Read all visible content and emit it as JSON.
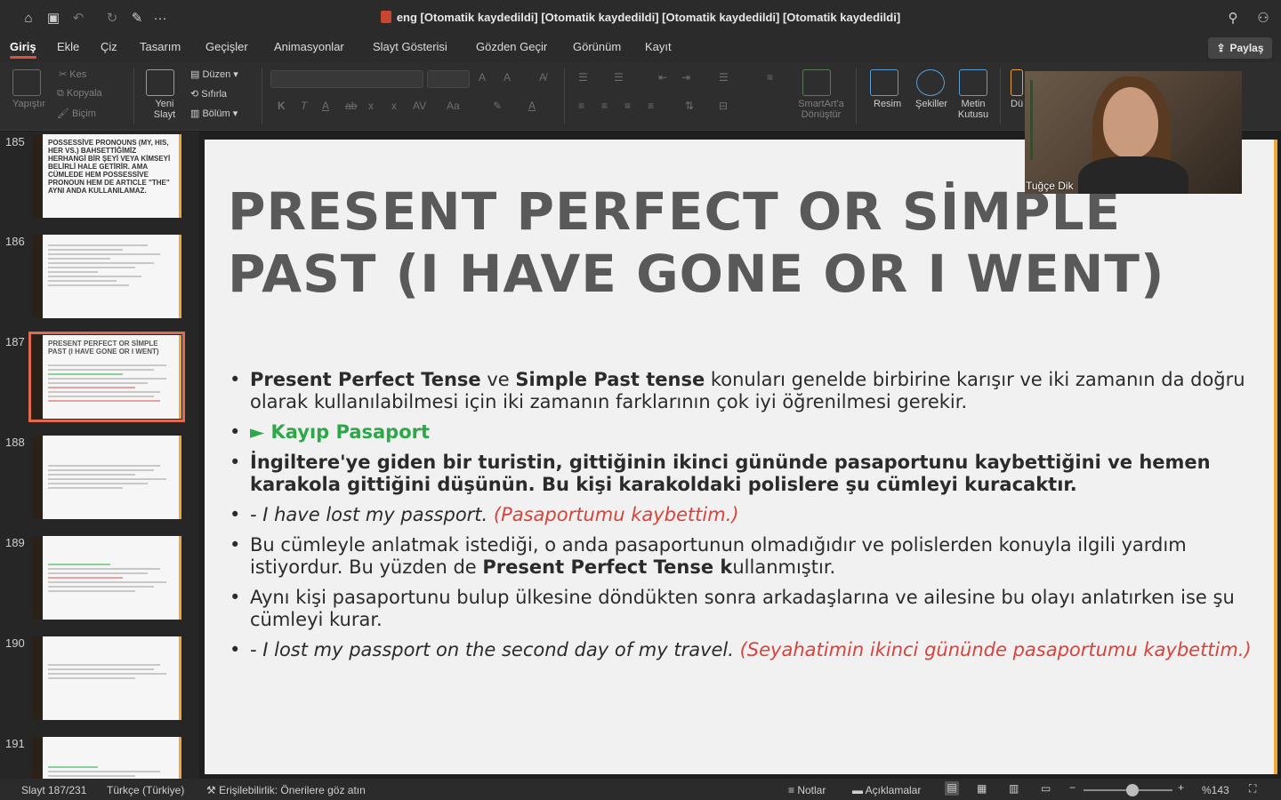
{
  "window": {
    "title": "eng [Otomatik kaydedildi] [Otomatik kaydedildi] [Otomatik kaydedildi] [Otomatik kaydedildi]"
  },
  "tabs": [
    "Giriş",
    "Ekle",
    "Çiz",
    "Tasarım",
    "Geçişler",
    "Animasyonlar",
    "Slayt Gösterisi",
    "Gözden Geçir",
    "Görünüm",
    "Kayıt"
  ],
  "share_label": "Paylaş",
  "ribbon": {
    "paste": "Yapıştır",
    "cut": "Kes",
    "copy": "Kopyala",
    "format": "Biçim",
    "new_slide": "Yeni Slayt",
    "layout": "Düzen",
    "reset": "Sıfırla",
    "section": "Bölüm",
    "smartart": "SmartArt'a Dönüştür",
    "picture": "Resim",
    "shapes": "Şekiller",
    "textbox": "Metin Kutusu",
    "arrange": "Dü"
  },
  "thumbnails": [
    {
      "num": "185",
      "text": "POSSESSİVE PRONOUNS (MY, HIS, HER VS.) BAHSETTİĞİMİZ HERHANGİ BİR ŞEYİ VEYA KİMSEYİ BELİRLİ HALE GETİRİR. AMA CÜMLEDE HEM POSSESSİVE PRONOUN HEM DE ARTICLE \"THE\" AYNI ANDA KULLANILAMAZ."
    },
    {
      "num": "186",
      "text": ""
    },
    {
      "num": "187",
      "text": "PRESENT PERFECT OR SİMPLE PAST (I HAVE GONE OR I WENT)"
    },
    {
      "num": "188",
      "text": ""
    },
    {
      "num": "189",
      "text": ""
    },
    {
      "num": "190",
      "text": ""
    },
    {
      "num": "191",
      "text": ""
    }
  ],
  "slide": {
    "title": "PRESENT PERFECT OR SİMPLE PAST (I HAVE GONE OR I WENT)",
    "b1_bold1": "Present Perfect Tense",
    "b1_t1": " ve ",
    "b1_bold2": "Simple Past tense",
    "b1_t2": " konuları genelde birbirine karışır ve iki zamanın da doğru olarak kullanılabilmesi için iki zamanın farklarının çok iyi öğrenilmesi gerekir.",
    "b2": "► Kayıp Pasaport",
    "b3": "İngiltere'ye giden bir turistin, gittiğinin ikinci gününde pasaportunu kaybettiğini ve hemen karakola gittiğini düşünün. Bu kişi karakoldaki polislere şu cümleyi kuracaktır.",
    "b4_en": "- I have lost my passport.",
    "b4_tr": " (Pasaportumu kaybettim.)",
    "b5_t1": "Bu cümleyle anlatmak istediği, o anda pasaportunun olmadığıdır ve polislerden konuyla ilgili yardım istiyordur. Bu yüzden de ",
    "b5_bold": "Present Perfect Tense k",
    "b5_t2": "ullanmıştır.",
    "b6": "Aynı kişi pasaportunu bulup ülkesine döndükten sonra arkadaşlarına ve ailesine bu olayı anlatırken ise şu cümleyi kurar.",
    "b7_en": "- I lost my passport on the second day of my travel.",
    "b7_tr": " (Seyahatimin ikinci gününde pasaportumu kaybettim.)"
  },
  "webcam_name": "Tuğçe Dik",
  "status": {
    "slide_pos": "Slayt 187/231",
    "language": "Türkçe (Türkiye)",
    "accessibility": "Erişilebilirlik: Önerilere göz atın",
    "notes": "Notlar",
    "comments": "Açıklamalar",
    "zoom": "%143",
    "zoom_level": 0.5
  }
}
